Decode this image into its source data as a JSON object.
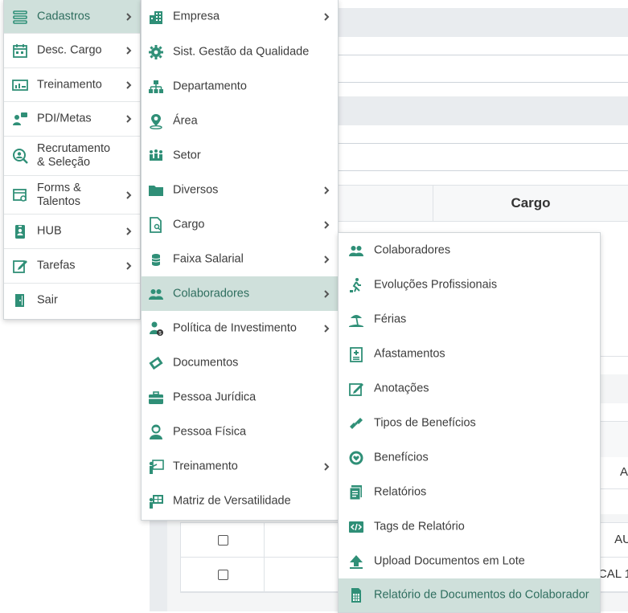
{
  "accent": "#2f8f77",
  "active_bg": "#cfe0db",
  "background": {
    "table_header": {
      "col_cargo": "Cargo"
    },
    "grid_rows": [
      {
        "checked": false,
        "text": "AU"
      },
      {
        "checked": false,
        "text": "CAL 1"
      }
    ],
    "fragment_a": "A"
  },
  "main_menu": {
    "items": [
      {
        "label": "Cadastros",
        "icon": "list-icon",
        "submenu": true,
        "active": true
      },
      {
        "label": "Desc. Cargo",
        "icon": "calendar-icon",
        "submenu": true
      },
      {
        "label": "Treinamento",
        "icon": "presentation-icon",
        "submenu": true
      },
      {
        "label": "PDI/Metas",
        "icon": "users-chat-icon",
        "submenu": true
      },
      {
        "label": "Recrutamento & Seleção",
        "icon": "search-person-icon",
        "submenu": false
      },
      {
        "label": "Forms & Talentos",
        "icon": "form-icon",
        "submenu": true
      },
      {
        "label": "HUB",
        "icon": "badge-icon",
        "submenu": true
      },
      {
        "label": "Tarefas",
        "icon": "edit-icon",
        "submenu": true
      },
      {
        "label": "Sair",
        "icon": "exit-icon",
        "submenu": false
      }
    ]
  },
  "cadastros_menu": {
    "items": [
      {
        "label": "Empresa",
        "icon": "building-icon",
        "submenu": true
      },
      {
        "label": "Sist. Gestão da Qualidade",
        "icon": "gear-icon",
        "submenu": false
      },
      {
        "label": "Departamento",
        "icon": "sitemap-icon",
        "submenu": false
      },
      {
        "label": "Área",
        "icon": "map-pin-icon",
        "submenu": false
      },
      {
        "label": "Setor",
        "icon": "group-icon",
        "submenu": false
      },
      {
        "label": "Diversos",
        "icon": "folder-icon",
        "submenu": true
      },
      {
        "label": "Cargo",
        "icon": "document-search-icon",
        "submenu": true
      },
      {
        "label": "Faixa Salarial",
        "icon": "coins-icon",
        "submenu": true
      },
      {
        "label": "Colaboradores",
        "icon": "users-icon",
        "submenu": true,
        "active": true
      },
      {
        "label": "Política de Investimento",
        "icon": "person-money-icon",
        "submenu": true
      },
      {
        "label": "Documentos",
        "icon": "money-tag-icon",
        "submenu": false
      },
      {
        "label": "Pessoa Jurídica",
        "icon": "briefcase-icon",
        "submenu": false
      },
      {
        "label": "Pessoa Física",
        "icon": "person-icon",
        "submenu": false
      },
      {
        "label": "Treinamento",
        "icon": "teacher-icon",
        "submenu": true
      },
      {
        "label": "Matriz de Versatilidade",
        "icon": "matrix-icon",
        "submenu": false
      }
    ]
  },
  "colaboradores_menu": {
    "items": [
      {
        "label": "Colaboradores",
        "icon": "users-icon"
      },
      {
        "label": "Evoluções Profissionais",
        "icon": "running-icon"
      },
      {
        "label": "Férias",
        "icon": "beach-icon"
      },
      {
        "label": "Afastamentos",
        "icon": "medical-file-icon"
      },
      {
        "label": "Anotações",
        "icon": "pencil-square-icon"
      },
      {
        "label": "Tipos de Benefícios",
        "icon": "hands-icon"
      },
      {
        "label": "Benefícios",
        "icon": "target-heart-icon"
      },
      {
        "label": "Relatórios",
        "icon": "report-icon"
      },
      {
        "label": "Tags de Relatório",
        "icon": "code-icon"
      },
      {
        "label": "Upload Documentos em Lote",
        "icon": "upload-icon"
      },
      {
        "label": "Relatório de Documentos do Colaborador",
        "icon": "file-table-icon",
        "active": true
      }
    ]
  }
}
